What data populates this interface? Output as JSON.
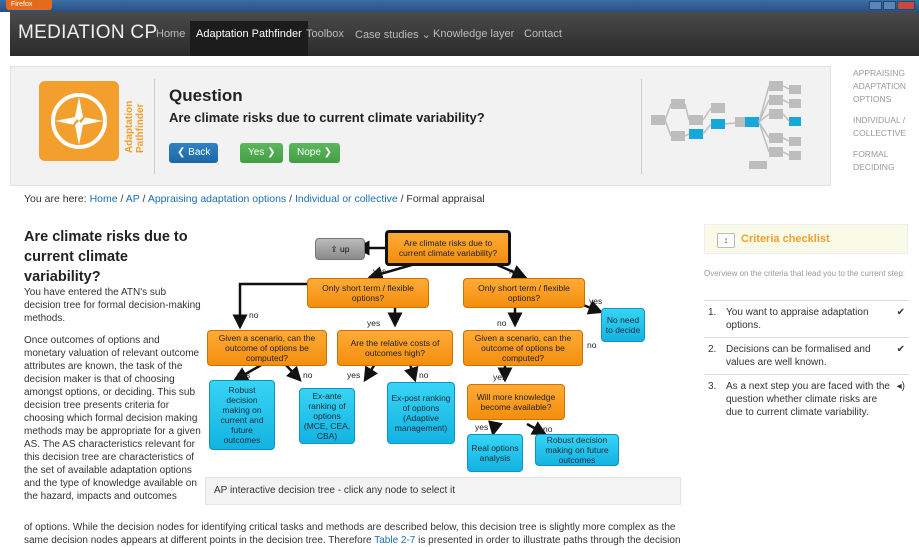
{
  "browser": {
    "button_label": "Firefox"
  },
  "navbar": {
    "brand": "MEDIATION CP",
    "items": [
      {
        "label": "Home"
      },
      {
        "label": "Adaptation Pathfinder"
      },
      {
        "label": "Toolbox"
      },
      {
        "label": "Case studies ⌄"
      },
      {
        "label": "Knowledge layer"
      },
      {
        "label": "Contact"
      }
    ]
  },
  "header": {
    "vertical_title_1": "Adaptation",
    "vertical_title_2": "Pathfinder",
    "question_title": "Question",
    "question_text": "Are climate risks due to current climate variability?",
    "back_label": "❮ Back",
    "yes_label": "Yes ❯",
    "nope_label": "Nope ❯"
  },
  "right_menu": [
    "APPRAISING ADAPTATION OPTIONS",
    "INDIVIDUAL / COLLECTIVE",
    "FORMAL DECIDING"
  ],
  "breadcrumb": {
    "prefix": "You are here: ",
    "links": [
      "Home",
      "AP",
      "Appraising adaptation options",
      "Individual or collective"
    ],
    "current": "Formal appraisal"
  },
  "main": {
    "title": "Are climate risks due to current climate variability?",
    "intro": "You have entered the ATN's sub decision tree for formal decision-making methods.",
    "intro2": "Once outcomes of options and monetary valuation of relevant outcome attributes are known, the task of the decision maker is that of choosing amongst options, or deciding. This sub decision tree presents criteria for choosing which formal decision making methods may be appropriate for a given AS. The AS characteristics relevant for this decision tree are characteristics of the set of available adaptation options and the type of knowledge available on the hazard, impacts and outcomes",
    "bottom_text_1": "of options. While the decision nodes for identifying critical tasks and methods are described below, this decision tree is slightly more complex as the",
    "bottom_text_2a": "same decision nodes appears at different points in the decision tree. Therefore ",
    "bottom_text_link": "Table 2-7",
    "bottom_text_2b": " is presented in order to illustrate paths through the decision"
  },
  "tree": {
    "caption": "AP interactive decision tree - click any node to select it",
    "up": "⇪ up",
    "root": "Are climate risks due to current climate variability?",
    "short_left": "Only short term / flexible options?",
    "short_right": "Only short term / flexible options?",
    "no_need": "No need to decide",
    "scenario_left": "Given a scenario, can the outcome of options be computed?",
    "relative_costs": "Are the relative costs of outcomes high?",
    "scenario_right": "Given a scenario, can the outcome of options be computed?",
    "robust_current": "Robust decision making on current and future outcomes",
    "ex_ante": "Ex-ante ranking of options (MCE, CEA, CBA)",
    "ex_post": "Ex-post ranking of options (Adaptive management)",
    "more_knowledge": "Will more knowledge become available?",
    "real_options": "Real options analysis",
    "robust_future": "Robust decision making on future outcomes",
    "yes": "yes",
    "no": "no"
  },
  "checklist": {
    "toggle": "↕",
    "title": "Criteria checklist",
    "description": "Overview on the criteria that lead you to the current step:",
    "items": [
      {
        "num": "1.",
        "text": "You want to appraise adaptation options.",
        "mark": "✔"
      },
      {
        "num": "2.",
        "text": "Decisions can be formalised and values are well known.",
        "mark": "✔"
      },
      {
        "num": "3.",
        "text": "As a next step you are faced with the question whether climate risks are due to current climate variability.",
        "mark": "◂)"
      }
    ]
  }
}
